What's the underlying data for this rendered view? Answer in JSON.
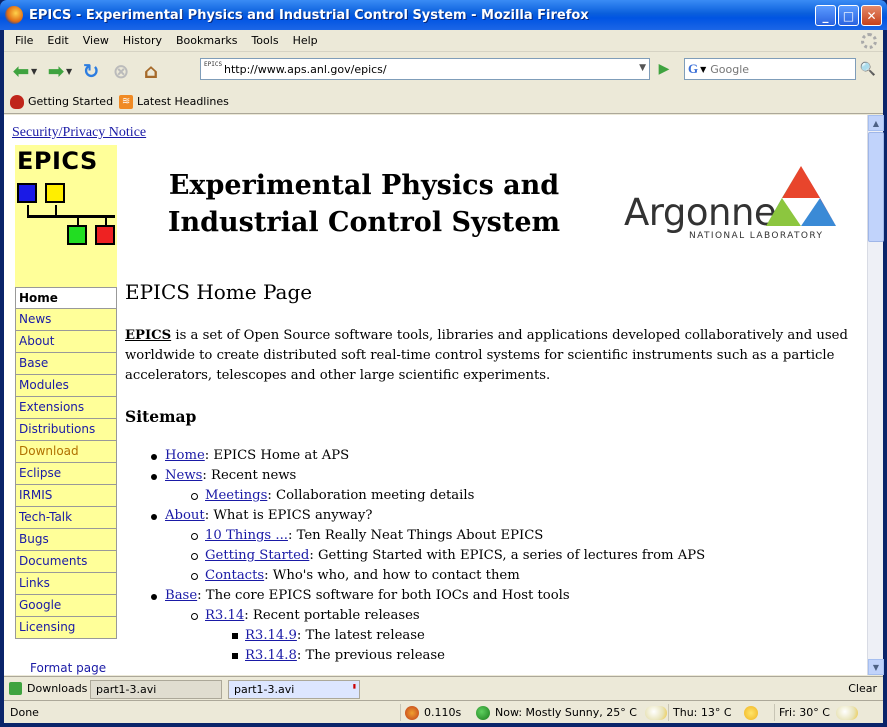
{
  "window": {
    "title": "EPICS - Experimental Physics and Industrial Control System - Mozilla Firefox"
  },
  "menu": [
    "File",
    "Edit",
    "View",
    "History",
    "Bookmarks",
    "Tools",
    "Help"
  ],
  "nav": {
    "url": "http://www.aps.anl.gov/epics/",
    "favicon_text": "EPICS",
    "search_engine": "G",
    "search_placeholder": "Google"
  },
  "bookmarks": [
    "Getting Started",
    "Latest Headlines"
  ],
  "page": {
    "security_notice": "Security/Privacy Notice",
    "logo_text": "EPICS",
    "banner_line1": "Experimental Physics and",
    "banner_line2": "Industrial Control System",
    "lab_name": "Argonne",
    "lab_sub": "NATIONAL LABORATORY",
    "sidebar": [
      "Home",
      "News",
      "About",
      "Base",
      "Modules",
      "Extensions",
      "Distributions",
      "Download",
      "Eclipse",
      "IRMIS",
      "Tech-Talk",
      "Bugs",
      "Documents",
      "Links",
      "Google",
      "Licensing"
    ],
    "format_page": "Format page",
    "heading": "EPICS Home Page",
    "intro_term": "EPICS",
    "intro_rest": " is a set of Open Source software tools, libraries and applications developed collaboratively and used worldwide to create distributed soft real-time control systems for scientific instruments such as a particle accelerators, telescopes and other large scientific experiments.",
    "sitemap_heading": "Sitemap",
    "sitemap": {
      "home": {
        "link": "Home",
        "text": ": EPICS Home at APS"
      },
      "news": {
        "link": "News",
        "text": ": Recent news"
      },
      "meetings": {
        "link": "Meetings",
        "text": ": Collaboration meeting details"
      },
      "about": {
        "link": "About",
        "text": ": What is EPICS anyway?"
      },
      "ten": {
        "link": "10 Things ...",
        "text": ": Ten Really Neat Things About EPICS"
      },
      "getting": {
        "link": "Getting Started",
        "text": ": Getting Started with EPICS, a series of lectures from APS"
      },
      "contacts": {
        "link": "Contacts",
        "text": ": Who's who, and how to contact them"
      },
      "base": {
        "link": "Base",
        "text": ": The core EPICS software for both IOCs and Host tools"
      },
      "r314": {
        "link": "R3.14",
        "text": ": Recent portable releases"
      },
      "r3149": {
        "link": "R3.14.9",
        "text": ": The latest release"
      },
      "r3148": {
        "link": "R3.14.8",
        "text": ": The previous release"
      }
    }
  },
  "downloads": {
    "label": "Downloads",
    "items": [
      "part1-3.avi",
      "part1-3.avi"
    ],
    "clear": "Clear"
  },
  "status": {
    "text": "Done",
    "timer": "0.110s",
    "now": "Now: Mostly Sunny, 25° C",
    "thu": "Thu: 13° C",
    "fri": "Fri: 30° C"
  }
}
